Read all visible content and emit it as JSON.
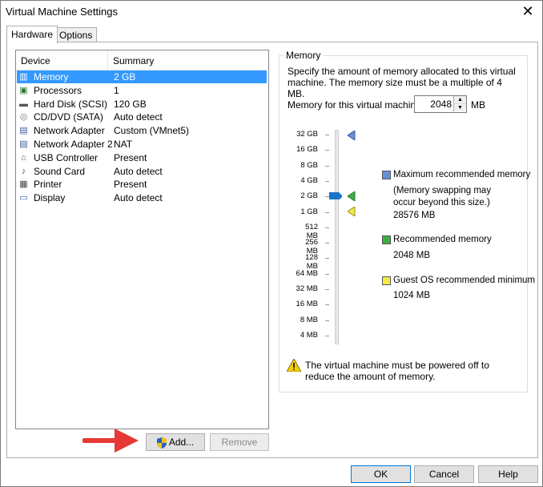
{
  "window": {
    "title": "Virtual Machine Settings",
    "close_glyph": "✕"
  },
  "tabs": [
    {
      "label": "Hardware",
      "active": true
    },
    {
      "label": "Options",
      "active": false
    }
  ],
  "device_list": {
    "columns": {
      "device": "Device",
      "summary": "Summary"
    },
    "rows": [
      {
        "icon": "memory-icon",
        "device": "Memory",
        "summary": "2 GB",
        "selected": true
      },
      {
        "icon": "processor-icon",
        "device": "Processors",
        "summary": "1"
      },
      {
        "icon": "hard-disk-icon",
        "device": "Hard Disk (SCSI)",
        "summary": "120 GB"
      },
      {
        "icon": "cd-dvd-icon",
        "device": "CD/DVD (SATA)",
        "summary": "Auto detect"
      },
      {
        "icon": "network-adapter-icon",
        "device": "Network Adapter",
        "summary": "Custom (VMnet5)"
      },
      {
        "icon": "network-adapter-icon",
        "device": "Network Adapter 2",
        "summary": "NAT"
      },
      {
        "icon": "usb-icon",
        "device": "USB Controller",
        "summary": "Present"
      },
      {
        "icon": "sound-icon",
        "device": "Sound Card",
        "summary": "Auto detect"
      },
      {
        "icon": "printer-icon",
        "device": "Printer",
        "summary": "Present"
      },
      {
        "icon": "display-icon",
        "device": "Display",
        "summary": "Auto detect"
      }
    ],
    "add_label": "Add...",
    "remove_label": "Remove"
  },
  "memory": {
    "group_label": "Memory",
    "description": "Specify the amount of memory allocated to this virtual machine. The memory size must be a multiple of 4 MB.",
    "field_label": "Memory for this virtual machine:",
    "value": "2048",
    "unit": "MB",
    "scale_ticks": [
      "32 GB",
      "16 GB",
      "8 GB",
      "4 GB",
      "2 GB",
      "1 GB",
      "512 MB",
      "256 MB",
      "128 MB",
      "64 MB",
      "32 MB",
      "16 MB",
      "8 MB",
      "4 MB"
    ],
    "slider_value": "2 GB",
    "legend": {
      "max_title": "Maximum recommended memory",
      "max_note": "(Memory swapping may occur beyond this size.)",
      "max_value": "28576 MB",
      "rec_title": "Recommended memory",
      "rec_value": "2048 MB",
      "min_title": "Guest OS recommended minimum",
      "min_value": "1024 MB"
    },
    "warning": "The virtual machine must be powered off to reduce the amount of memory.",
    "colors": {
      "max": "#6a8fd6",
      "recommended": "#3cb043",
      "minimum": "#f5e94a",
      "thumb": "#1a73c8"
    }
  },
  "footer": {
    "ok": "OK",
    "cancel": "Cancel",
    "help": "Help"
  }
}
